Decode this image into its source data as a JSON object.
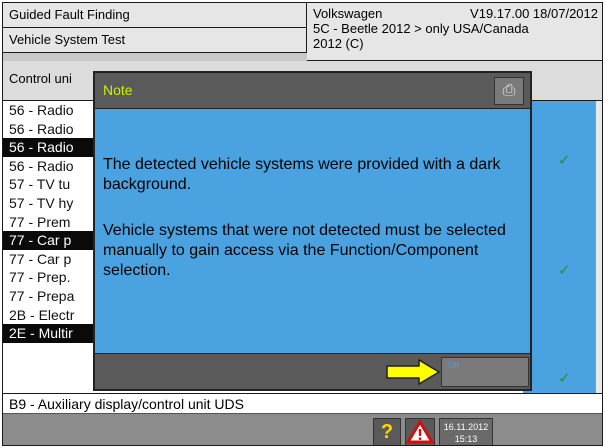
{
  "header": {
    "app_title": "Guided Fault Finding",
    "subtitle": "Vehicle System Test",
    "brand": "Volkswagen",
    "version": "V19.17.00 18/07/2012",
    "vehicle_line1": "5C - Beetle 2012 > only USA/Canada",
    "vehicle_line2": "2012 (C)"
  },
  "control_row_label": "Control uni",
  "list": {
    "rows": [
      {
        "text": "56 - Radio",
        "dark": false
      },
      {
        "text": "56 - Radio",
        "dark": false
      },
      {
        "text": "56 - Radio",
        "dark": true
      },
      {
        "text": "56 - Radio",
        "dark": false
      },
      {
        "text": "57 - TV tu",
        "dark": false
      },
      {
        "text": "57 - TV hy",
        "dark": false
      },
      {
        "text": "77 - Prem",
        "dark": false
      },
      {
        "text": "77 - Car p",
        "dark": true
      },
      {
        "text": "77 - Car p",
        "dark": false
      },
      {
        "text": "77 - Prep.",
        "dark": false
      },
      {
        "text": "77 - Prepa",
        "dark": false
      },
      {
        "text": "2B - Electr",
        "dark": false
      },
      {
        "text": "2E - Multir",
        "dark": true
      }
    ],
    "checks": [
      "✓",
      "✓",
      "✓"
    ],
    "bottom_row": "B9 - Auxiliary display/control unit UDS"
  },
  "dialog": {
    "title": "Note",
    "paragraph1": "The detected vehicle systems were provided with a dark background.",
    "paragraph2": "Vehicle systems that were not detected must be selected manually to gain access via the Function/Component selection.",
    "ok_label": "OK"
  },
  "statusbar": {
    "help_label": "?",
    "date": "16.11.2012",
    "time": "15:13"
  },
  "colors": {
    "dialog_bg": "#4aa3e0",
    "title_text": "#c8f000",
    "arrow": "#ffff00"
  }
}
